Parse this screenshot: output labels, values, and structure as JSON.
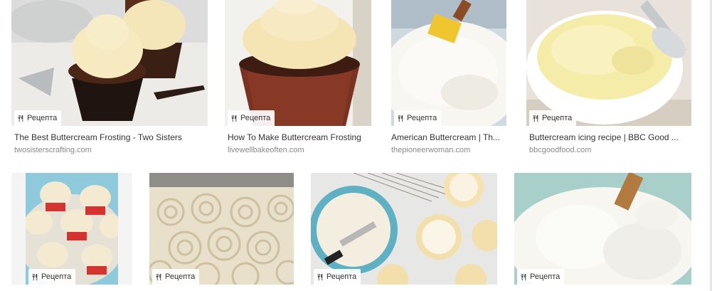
{
  "badge_icon": "fork-knife-icon",
  "results": [
    {
      "badge": "Рецепта",
      "title": "The Best Buttercream Frosting - Two Sisters",
      "domain": "twosisterscrafting.com"
    },
    {
      "badge": "Рецепта",
      "title": "How To Make Buttercream Frosting",
      "domain": "livewellbakeoften.com"
    },
    {
      "badge": "Рецепта",
      "title": "American Buttercream | Th...",
      "domain": "thepioneerwoman.com"
    },
    {
      "badge": "Рецепта",
      "title": "Buttercream icing recipe | BBC Good ...",
      "domain": "bbcgoodfood.com"
    },
    {
      "badge": "Рецепта"
    },
    {
      "badge": "Рецепта"
    },
    {
      "badge": "Рецепта"
    },
    {
      "badge": "Рецепта"
    }
  ]
}
